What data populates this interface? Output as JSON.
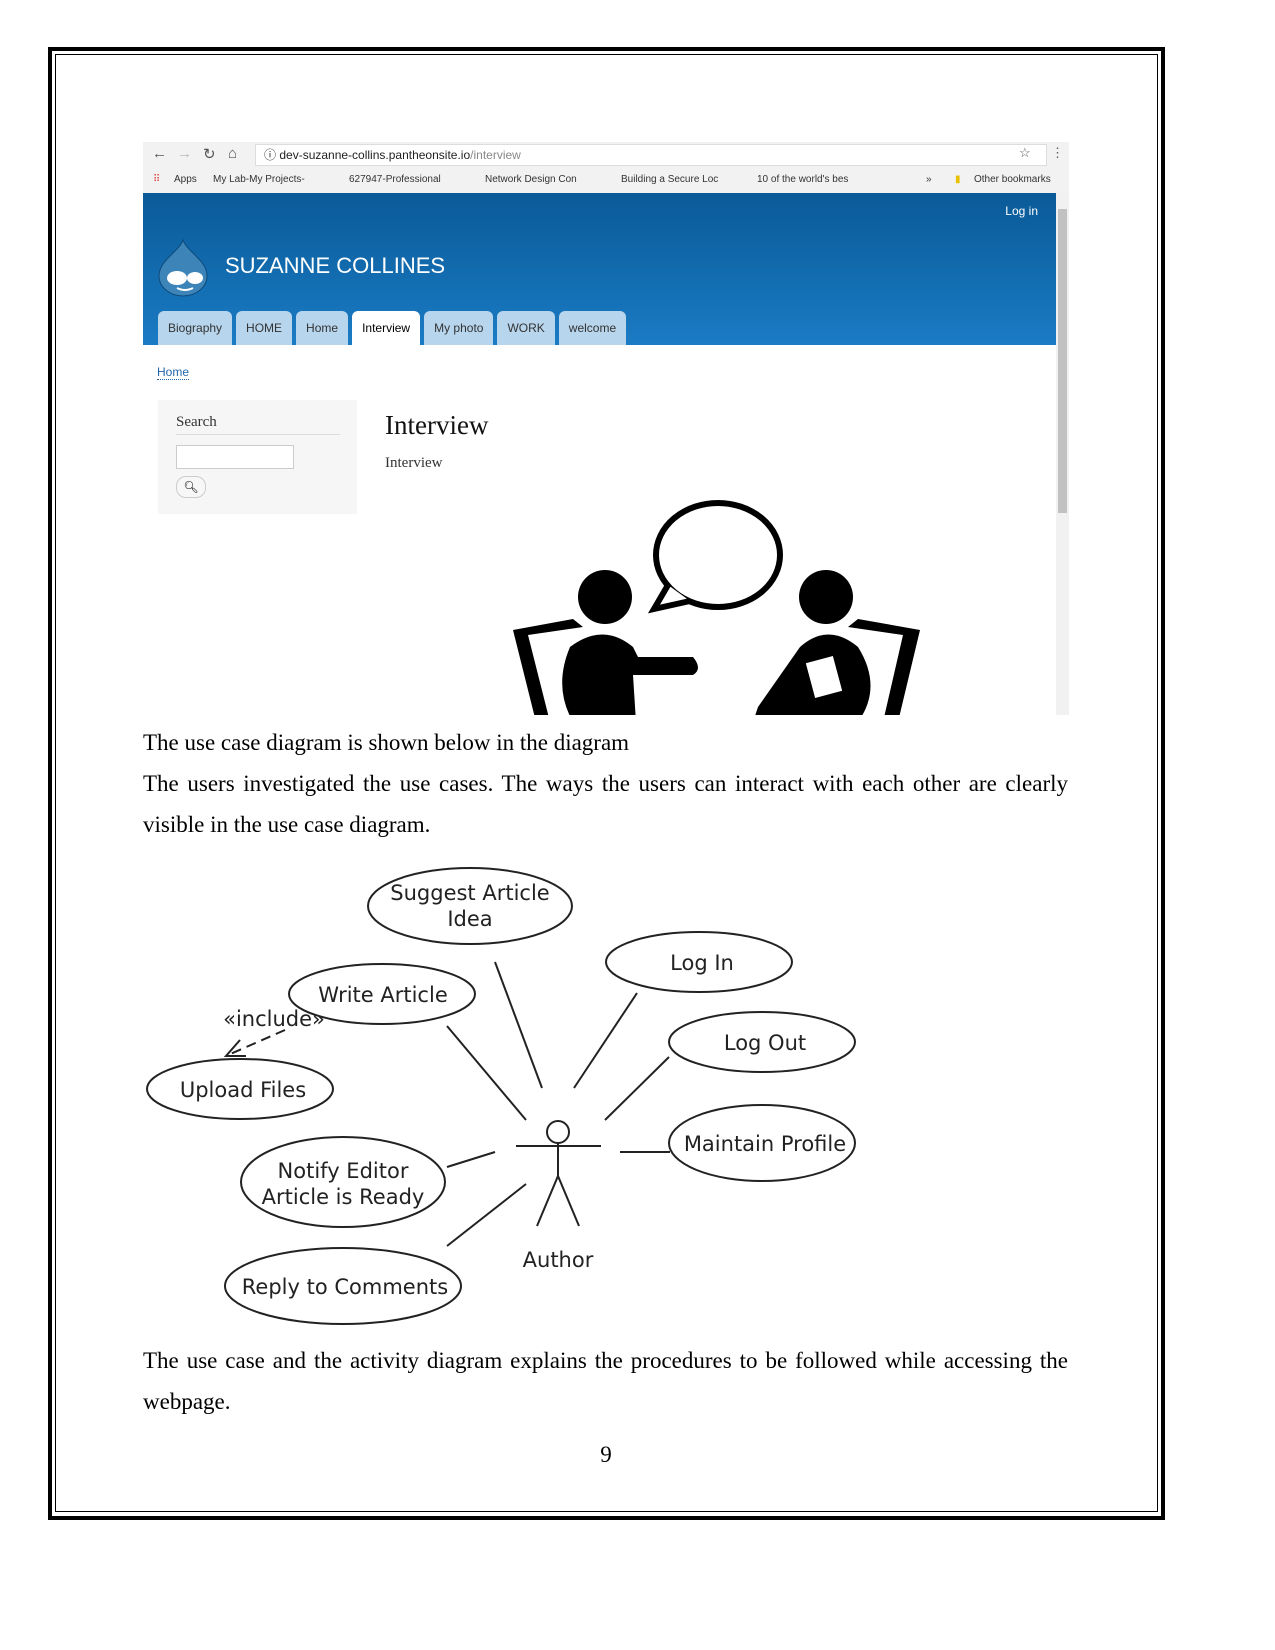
{
  "browser": {
    "url_host": "dev-suzanne-collins.pantheonsite.io",
    "url_path": "/interview",
    "bookmarks": [
      "Apps",
      "My Lab-My Projects-",
      "627947-Professional",
      "Network Design Con",
      "Building a Secure Loc",
      "10 of the world's bes",
      "»",
      "Other bookmarks"
    ]
  },
  "site": {
    "login": "Log in",
    "name": "SUZANNE COLLINES",
    "tabs": [
      "Biography",
      "HOME",
      "Home",
      "Interview",
      "My photo",
      "WORK",
      "welcome"
    ],
    "active_tab": "Interview",
    "breadcrumb": "Home",
    "search_label": "Search",
    "page_title": "Interview",
    "page_body": "Interview"
  },
  "text": {
    "p1": "The use case diagram is shown below in the diagram",
    "p2": "The users investigated the use cases. The ways the users can interact with each other are clearly visible in the use case diagram.",
    "p3": "The use case and the activity diagram explains the procedures to be followed while accessing the webpage.",
    "page_number": "9"
  },
  "diagram": {
    "actor": "Author",
    "use_cases": [
      "Suggest Article Idea",
      "Log In",
      "Write Article",
      "Log Out",
      "Upload Files",
      "Maintain Profile",
      "Notify Editor Article is Ready",
      "Reply to Comments"
    ],
    "include_label": "«include»"
  }
}
